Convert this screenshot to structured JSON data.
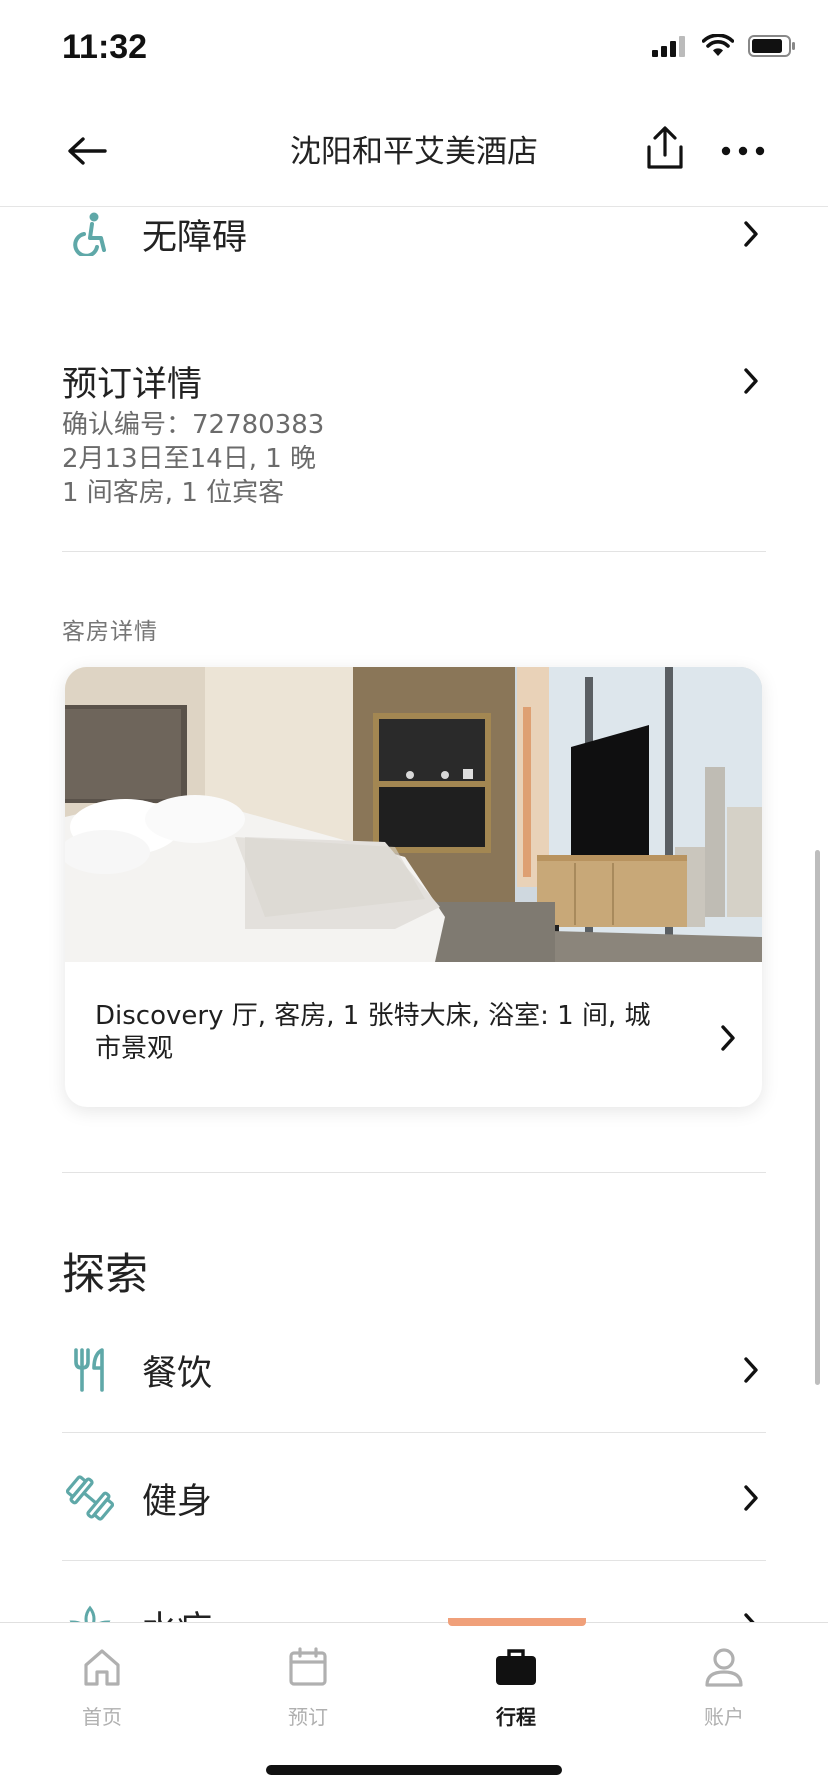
{
  "status_bar": {
    "time": "11:32"
  },
  "nav": {
    "title": "沈阳和平艾美酒店"
  },
  "accessibility": {
    "label": "无障碍"
  },
  "booking": {
    "title": "预订详情",
    "confirmation": "确认编号：72780383",
    "dates": "2月13日至14日, 1 晚",
    "guests": "1 间客房, 1 位宾客"
  },
  "room_section": {
    "caption": "客房详情",
    "description": "Discovery 厅, 客房, 1 张特大床, 浴室: 1 间, 城市景观"
  },
  "explore": {
    "title": "探索",
    "items": [
      {
        "label": "餐饮",
        "icon": "fork-knife-icon"
      },
      {
        "label": "健身",
        "icon": "dumbbell-icon"
      },
      {
        "label": "水疗",
        "icon": "lotus-icon"
      }
    ]
  },
  "tabs": [
    {
      "label": "首页",
      "icon": "home-icon",
      "active": false
    },
    {
      "label": "预订",
      "icon": "calendar-icon",
      "active": false
    },
    {
      "label": "行程",
      "icon": "briefcase-icon",
      "active": true
    },
    {
      "label": "账户",
      "icon": "user-icon",
      "active": false
    }
  ],
  "colors": {
    "accent_teal": "#5fa8a8",
    "tab_indicator": "#f0a07a"
  }
}
